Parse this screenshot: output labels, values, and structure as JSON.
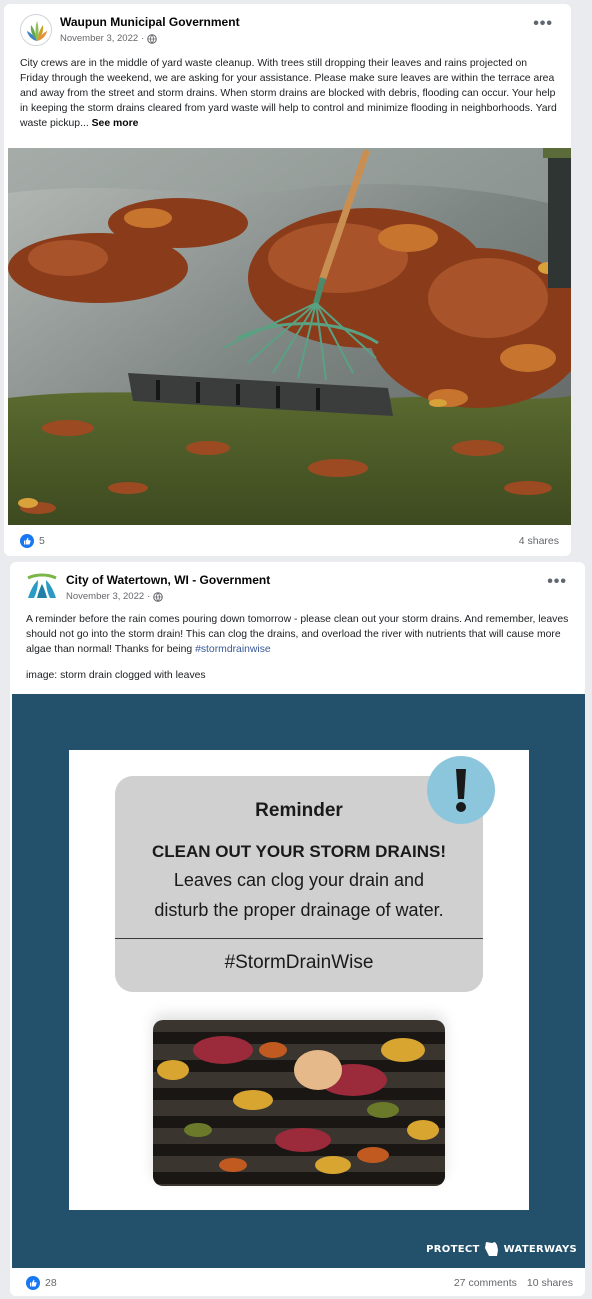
{
  "post1": {
    "author": "Waupun Municipal Government",
    "date": "November 3, 2022",
    "body": "City crews are in the middle of yard waste cleanup.  With trees still dropping their leaves and rains projected on Friday through the weekend, we are asking for your assistance.  Please make sure leaves are within the terrace area and away from the street and storm drains.  When storm drains are blocked with debris, flooding can occur.  Your help in keeping the storm drains cleared from yard waste will help to control and minimize flooding in neighborhoods.  Yard waste pickup...",
    "see_more": "See more",
    "image_alt": "Rake pulling wet autumn leaves away from a street storm drain",
    "reactions_count": "5",
    "shares": "4 shares"
  },
  "post2": {
    "author": "City of Watertown, WI - Government",
    "date": "November 3, 2022",
    "body": "A reminder before the rain comes pouring down tomorrow - please clean out your storm drains. And remember, leaves should not go into the storm drain! This can clog the drains, and overload the river with nutrients that will cause more algae than normal! Thanks for being",
    "hashtag": "#stormdrainwise",
    "caption": "image: storm drain clogged with leaves",
    "graphic": {
      "title": "Reminder",
      "headline": "CLEAN OUT YOUR STORM DRAINS!",
      "line1": "Leaves can clog your drain and",
      "line2": "disturb the proper drainage of water.",
      "tag": "#StormDrainWise",
      "logo_left": "PROTECT",
      "logo_right": "WATERWAYS"
    },
    "reactions_count": "28",
    "comments": "27 comments",
    "shares": "10 shares"
  },
  "colors": {
    "like_blue": "#1877f2",
    "graphic_bg": "#23506a",
    "bubble_gray": "#d0d0d0",
    "alert_blue": "#8cc6dd",
    "hashtag_link": "#385898"
  },
  "icons": {
    "more": "more-horizontal-icon",
    "audience": "globe-icon",
    "like": "thumbs-up-icon",
    "alert": "exclamation-icon"
  }
}
